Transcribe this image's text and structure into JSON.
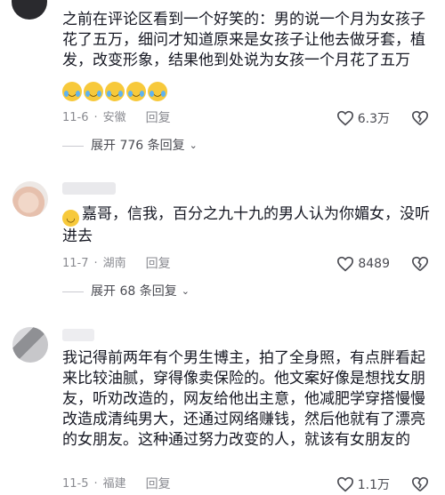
{
  "comments": [
    {
      "text": "之前在评论区看到一个好笑的：男的说一个月为女孩子花了五万，细问才知道原来是女孩子让他去做牙套，植发，改变形象，结果他到处说为女孩一个月花了五万",
      "emoji_icon": "crying-laughing-emoji",
      "emoji_count": 5,
      "date": "11-6",
      "location": "安徽",
      "reply_label": "回复",
      "likes": "6.3万",
      "expand_label": "展开 776 条回复"
    },
    {
      "text": "嘉哥，信我，百分之九十九的男人认为你媚女，没听进去",
      "emoji_icon": "grinning-emoji",
      "date": "11-7",
      "location": "湖南",
      "reply_label": "回复",
      "likes": "8489",
      "expand_label": "展开 68 条回复"
    },
    {
      "text": "我记得前两年有个男生博主，拍了全身照，有点胖看起来比较油腻，穿得像卖保险的。他文案好像是想找女朋友，听劝改造的，网友给他出主意，他减肥学穿搭慢慢改造成清纯男大，还通过网络赚钱，然后他就有了漂亮的女朋友。这种通过努力改变的人，就该有女朋友的",
      "date": "11-5",
      "location": "福建",
      "reply_label": "回复",
      "likes": "1.1万"
    }
  ],
  "separator": "·",
  "colors": {
    "text": "#161823",
    "meta": "#8a8b91"
  }
}
